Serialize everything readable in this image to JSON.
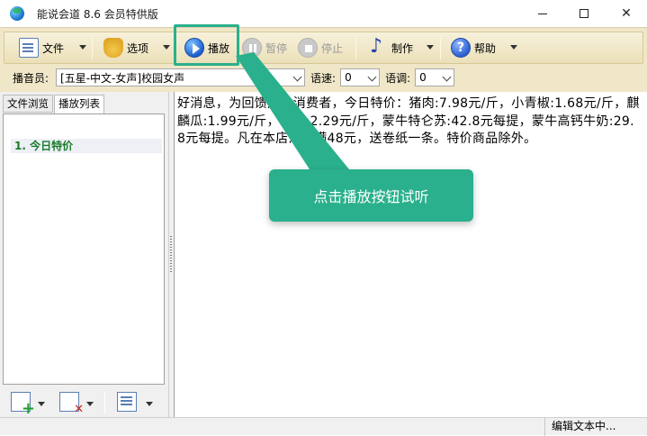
{
  "window": {
    "title": "能说会道 8.6 会员特供版"
  },
  "toolbar": {
    "file_label": "文件",
    "options_label": "选项",
    "play_label": "播放",
    "pause_label": "暂停",
    "stop_label": "停止",
    "produce_label": "制作",
    "help_label": "帮助"
  },
  "voice_bar": {
    "speaker_label": "播音员:",
    "speaker_value": "[五星-中文-女声]校园女声",
    "speed_label": "语速:",
    "speed_value": "0",
    "pitch_label": "语调:",
    "pitch_value": "0"
  },
  "left_panel": {
    "tabs": [
      {
        "label": "文件浏览"
      },
      {
        "label": "播放列表"
      }
    ],
    "playlist": [
      {
        "label": "1.  今日特价"
      }
    ]
  },
  "editor": {
    "text": "好消息，为回馈广大消费者，今日特价：猪肉:7.98元/斤，小青椒:1.68元/斤，麒麟瓜:1.99元/斤，糯米:2.29元/斤，蒙牛特仑苏:42.8元每提，蒙牛高钙牛奶:29.8元每提。凡在本店消费满48元，送卷纸一条。特价商品除外。"
  },
  "status": {
    "text": "编辑文本中..."
  },
  "callout": {
    "text": "点击播放按钮试听",
    "color": "#2ab08c"
  }
}
